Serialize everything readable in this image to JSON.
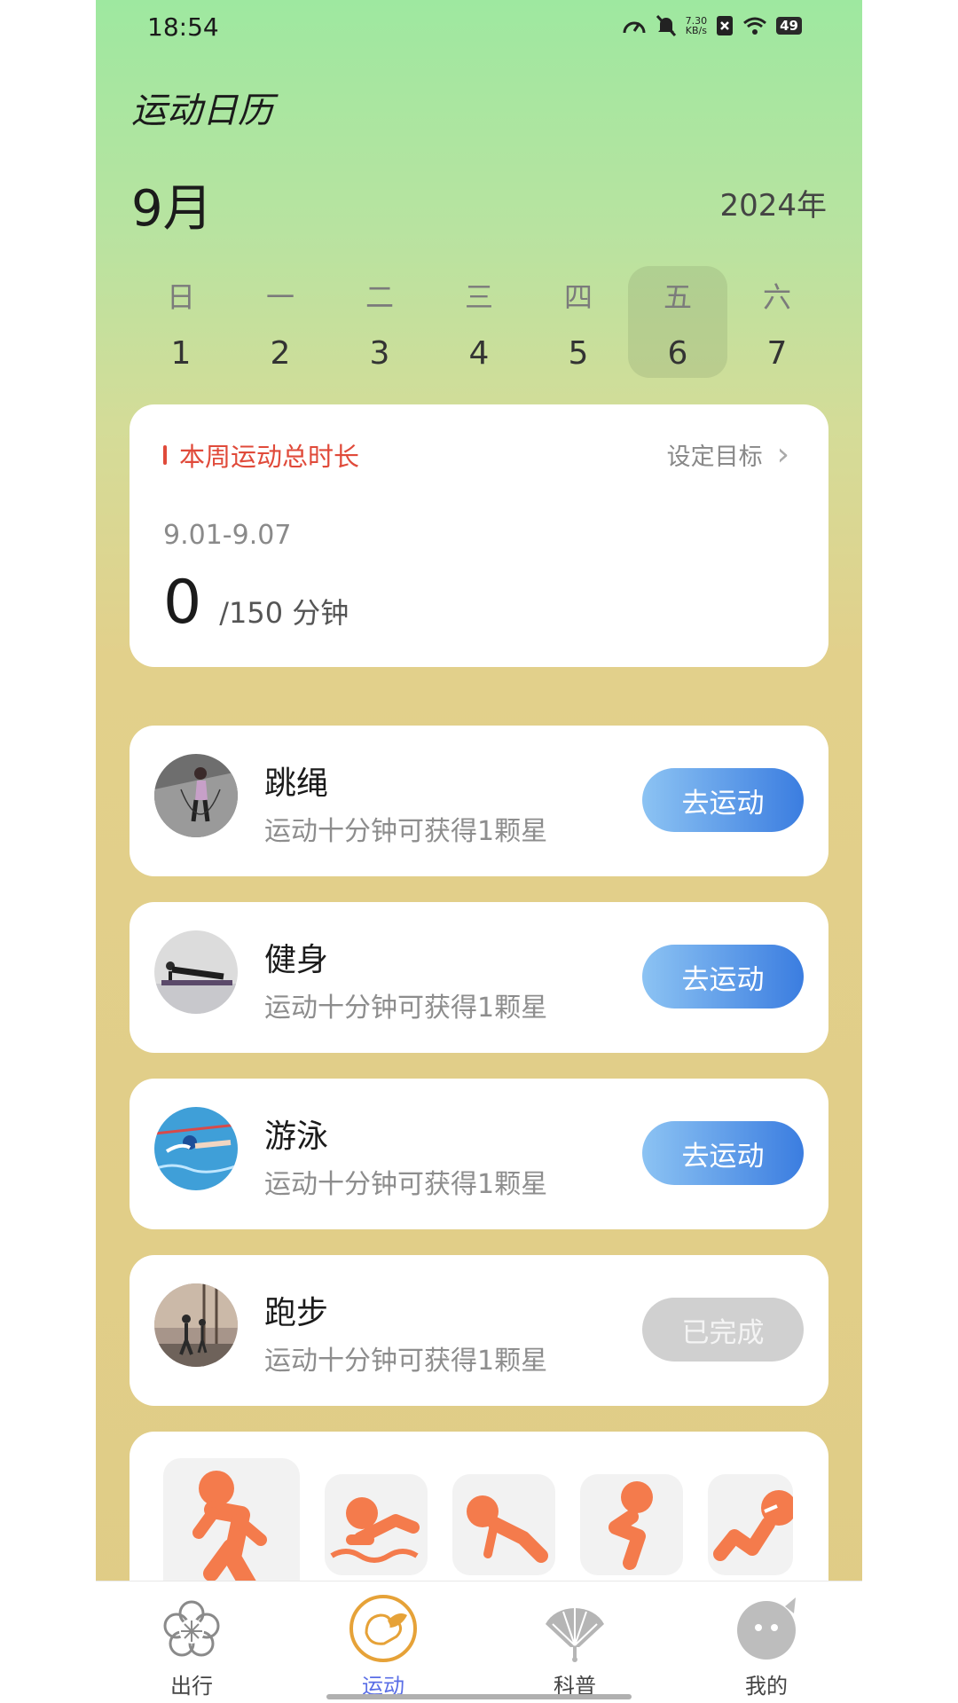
{
  "status": {
    "time": "18:54",
    "netspeed_value": "7.30",
    "netspeed_unit": "KB/s",
    "battery": "49"
  },
  "header": {
    "title": "运动日历",
    "month": "9月",
    "year": "2024年"
  },
  "week": [
    {
      "weekday": "日",
      "date": "1",
      "selected": false
    },
    {
      "weekday": "一",
      "date": "2",
      "selected": false
    },
    {
      "weekday": "二",
      "date": "3",
      "selected": false
    },
    {
      "weekday": "三",
      "date": "4",
      "selected": false
    },
    {
      "weekday": "四",
      "date": "5",
      "selected": false
    },
    {
      "weekday": "五",
      "date": "6",
      "selected": true
    },
    {
      "weekday": "六",
      "date": "7",
      "selected": false
    }
  ],
  "summary": {
    "title": "本周运动总时长",
    "goal_link": "设定目标",
    "date_range": "9.01-9.07",
    "total": "0",
    "target": "/150 分钟"
  },
  "activities": [
    {
      "name": "跳绳",
      "desc": "运动十分钟可获得1颗星",
      "button": "去运动",
      "done": false
    },
    {
      "name": "健身",
      "desc": "运动十分钟可获得1颗星",
      "button": "去运动",
      "done": false
    },
    {
      "name": "游泳",
      "desc": "运动十分钟可获得1颗星",
      "button": "去运动",
      "done": false
    },
    {
      "name": "跑步",
      "desc": "运动十分钟可获得1颗星",
      "button": "已完成",
      "done": true
    }
  ],
  "sport_icons": [
    "running-icon",
    "swimming-icon",
    "pushup-icon",
    "squat-icon",
    "situp-icon"
  ],
  "tabs": [
    {
      "label": "出行",
      "icon": "flower-icon",
      "active": false
    },
    {
      "label": "运动",
      "icon": "sport-icon",
      "active": true
    },
    {
      "label": "科普",
      "icon": "fan-icon",
      "active": false
    },
    {
      "label": "我的",
      "icon": "profile-face-icon",
      "active": false
    }
  ],
  "colors": {
    "accent_red": "#e04a3a",
    "button_blue": "#3b7de0",
    "tab_active": "#5a6ee6",
    "sport_orange": "#f47b4c"
  }
}
